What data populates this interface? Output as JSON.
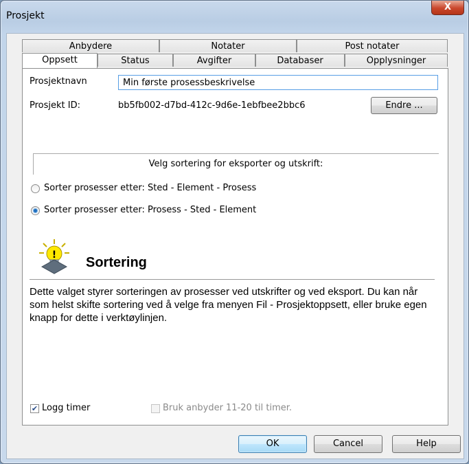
{
  "window": {
    "title": "Prosjekt",
    "close_glyph": "X"
  },
  "tabs": {
    "row1": [
      "Anbydere",
      "Notater",
      "Post notater"
    ],
    "row2": [
      "Oppsett",
      "Status",
      "Avgifter",
      "Databaser",
      "Opplysninger"
    ],
    "active": "Oppsett"
  },
  "form": {
    "name_label": "Prosjektnavn",
    "name_value": "Min første prosessbeskrivelse",
    "id_label": "Prosjekt ID:",
    "id_value": "bb5fb002-d7bd-412c-9d6e-1ebfbee2bbc6",
    "change_button": "Endre ..."
  },
  "sorting": {
    "group_label": "Velg sortering for eksporter og utskrift:",
    "option1": "Sorter prosesser etter: Sted - Element - Prosess",
    "option2": "Sorter prosesser etter: Prosess - Sted - Element",
    "selected": "option2"
  },
  "hint": {
    "icon": "lightbulb-hint-icon",
    "title": "Sortering",
    "text": "Dette valget styrer sorteringen av prosesser ved utskrifter og ved eksport. Du kan når som helst skifte sortering ved å velge fra menyen Fil - Prosjektoppsett, eller bruke egen knapp for dette i verktøylinjen."
  },
  "options": {
    "log_hours": "Logg timer",
    "log_hours_checked": true,
    "bidder_hours": "Bruk anbyder 11-20 til timer.",
    "bidder_hours_checked": false
  },
  "buttons": {
    "ok": "OK",
    "cancel": "Cancel",
    "help": "Help"
  }
}
